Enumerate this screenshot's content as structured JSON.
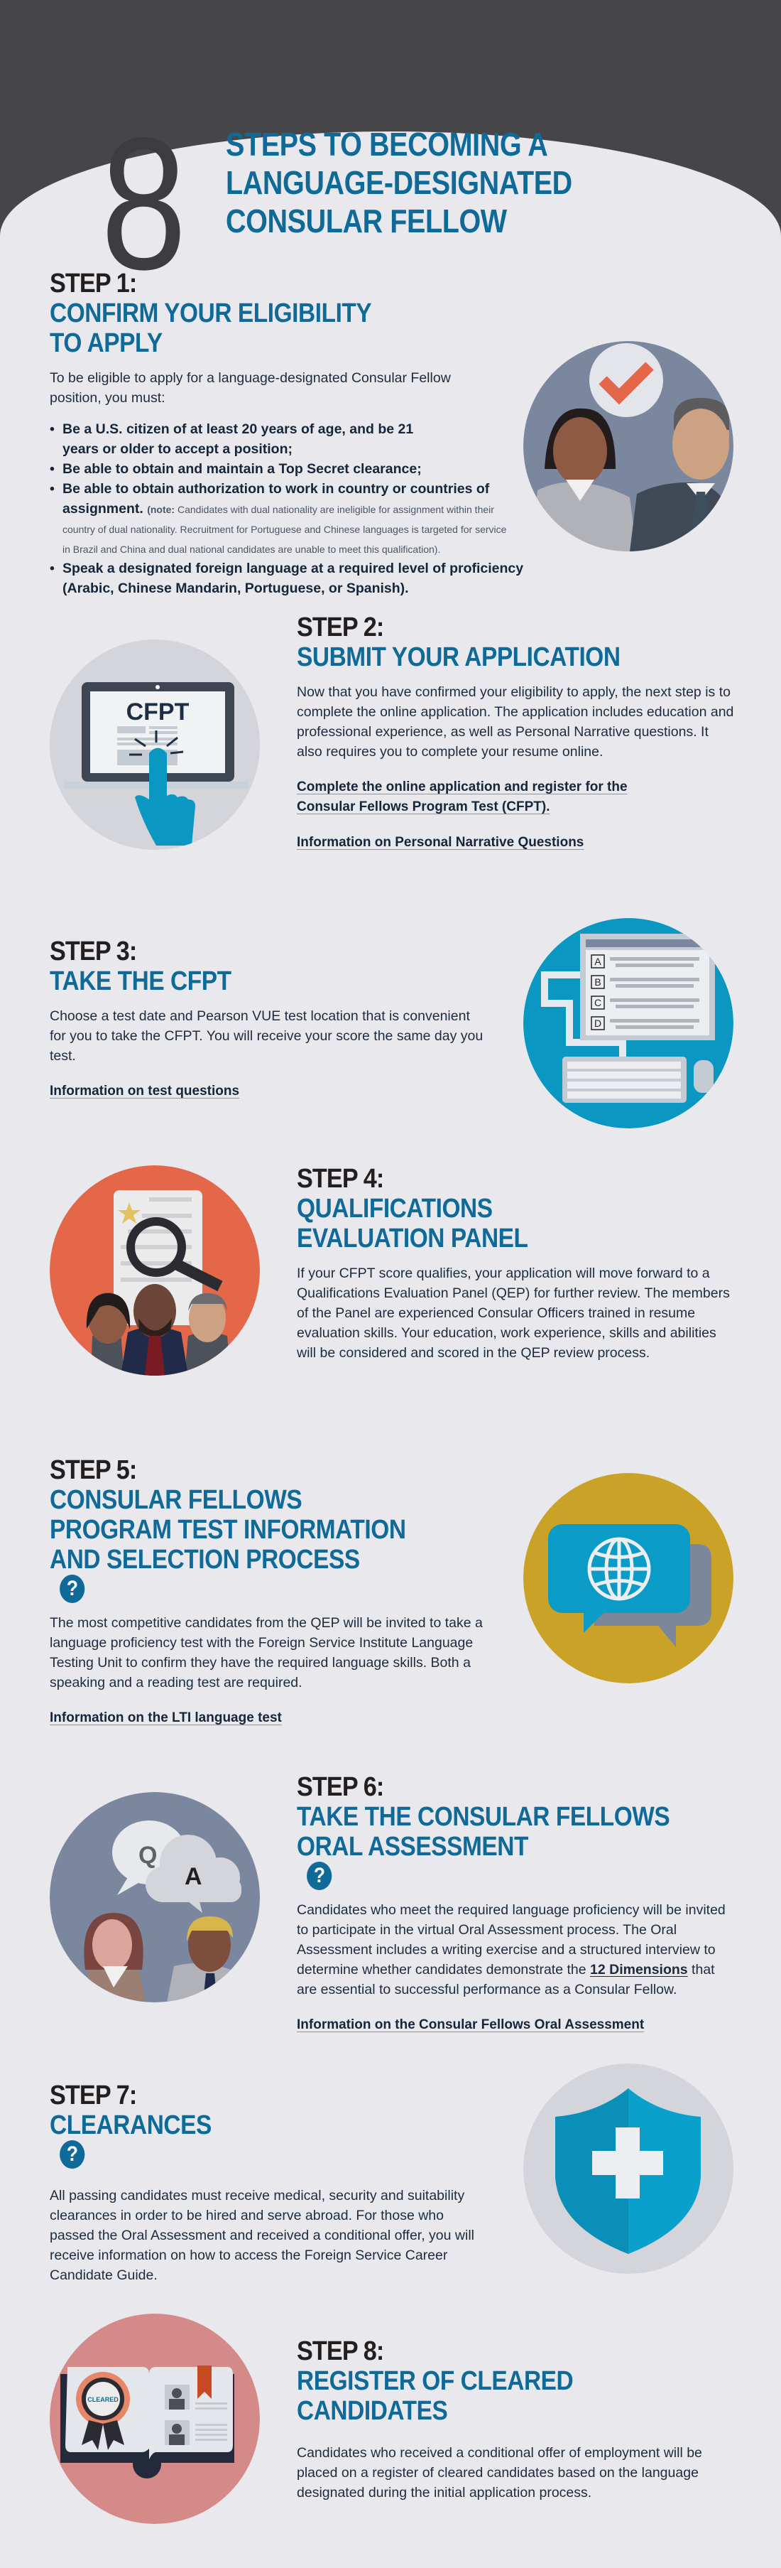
{
  "header": {
    "big_number": "8",
    "title_lines": [
      "STEPS TO BECOMING A",
      "LANGUAGE-DESIGNATED",
      "CONSULAR FELLOW"
    ]
  },
  "colors": {
    "title_blue": "#0f6a98",
    "dark_band": "#464648",
    "paper": "#e9e9ed",
    "orange": "#e5674a",
    "gold": "#c9a227",
    "cyan": "#0a9cc6",
    "rose": "#d58a8a",
    "slate": "#7b879e"
  },
  "steps": [
    {
      "label": "STEP 1:",
      "title_lines": [
        "CONFIRM YOUR ELIGIBILITY",
        "TO APPLY"
      ],
      "intro": "To be eligible to apply for a language-designated Consular Fellow position, you must:",
      "requirements": [
        "Be a U.S. citizen of at least 20 years of age, and be 21 years or older to accept a position;",
        "Be able to obtain and maintain a Top Secret clearance;",
        "Be able to obtain authorization to work in country or countries of assignment.",
        "Speak a designated foreign language at a required level of proficiency (Arabic, Chinese Mandarin, Portuguese, or Spanish)."
      ],
      "note_label": "(note:",
      "note_text": "Candidates with dual nationality are ineligible for assignment within their country of dual nationality.  Recruitment for Portuguese and Chinese languages is targeted for service in Brazil and China and dual national candidates are unable to meet this qualification).",
      "icon": "people-checkmark-icon"
    },
    {
      "label": "STEP 2:",
      "title_lines": [
        "SUBMIT YOUR APPLICATION"
      ],
      "body": "Now that you have confirmed your eligibility to apply, the next step is to complete the online application. The application includes education and professional experience, as well as Personal Narrative questions. It also requires you to complete your resume online.",
      "links": [
        "Complete the online application and register for the Consular Fellows Program Test (CFPT).",
        "Information on Personal Narrative Questions"
      ],
      "icon": "laptop-click-icon",
      "icon_text": "CFPT"
    },
    {
      "label": "STEP 3:",
      "title_lines": [
        "TAKE THE CFPT"
      ],
      "body": "Choose a test date and Pearson VUE test location that is convenient for you to take the CFPT. You will receive your score the same day you test.",
      "links": [
        "Information on test questions"
      ],
      "icon": "computer-test-icon",
      "icon_options": [
        "A",
        "B",
        "C",
        "D"
      ]
    },
    {
      "label": "STEP 4:",
      "title_lines": [
        "QUALIFICATIONS",
        "EVALUATION PANEL"
      ],
      "body": "If your CFPT score qualifies, your application will move forward to a Qualifications Evaluation Panel (QEP) for further review. The members of the Panel are experienced Consular Officers trained in resume evaluation skills. Your education, work experience, skills and abilities will be considered and scored in the QEP review process.",
      "icon": "panel-review-icon"
    },
    {
      "label": "STEP 5:",
      "title_lines": [
        "CONSULAR FELLOWS",
        "PROGRAM TEST INFORMATION",
        "AND SELECTION PROCESS"
      ],
      "help": "?",
      "body": "The most competitive candidates from the QEP will be invited to take a language proficiency test with the Foreign Service Institute Language Testing Unit to confirm they have the required language skills.  Both a speaking and a reading test are required.",
      "links": [
        "Information on the LTI language test"
      ],
      "icon": "globe-speech-icon"
    },
    {
      "label": "STEP 6:",
      "title_lines": [
        "TAKE THE CONSULAR FELLOWS",
        "ORAL ASSESSMENT"
      ],
      "help": "?",
      "body_before": "Candidates who meet the required language proficiency will be invited to participate in the virtual Oral Assessment process. The Oral Assessment includes a writing exercise and a structured interview to determine whether candidates demonstrate the ",
      "body_link": "12 Dimensions",
      "body_after": " that are essential to successful performance as a Consular Fellow.",
      "links": [
        "Information on the Consular Fellows Oral Assessment"
      ],
      "icon": "qa-interview-icon",
      "icon_q": "Q",
      "icon_a": "A"
    },
    {
      "label": "STEP 7:",
      "title_lines": [
        "CLEARANCES"
      ],
      "help": "?",
      "body": "All passing candidates must receive medical, security and suitability clearances in order to be hired and serve abroad. For those who passed the Oral Assessment and received a conditional offer, you will receive information on how to access the Foreign Service Career Candidate Guide.",
      "icon": "medical-shield-icon"
    },
    {
      "label": "STEP 8:",
      "title_lines": [
        "REGISTER OF CLEARED",
        "CANDIDATES"
      ],
      "body": "Candidates who received a conditional offer of employment will be placed on a register of cleared candidates based on the language designated during the initial application process.",
      "icon": "cleared-register-icon",
      "icon_badge": "CLEARED"
    }
  ]
}
